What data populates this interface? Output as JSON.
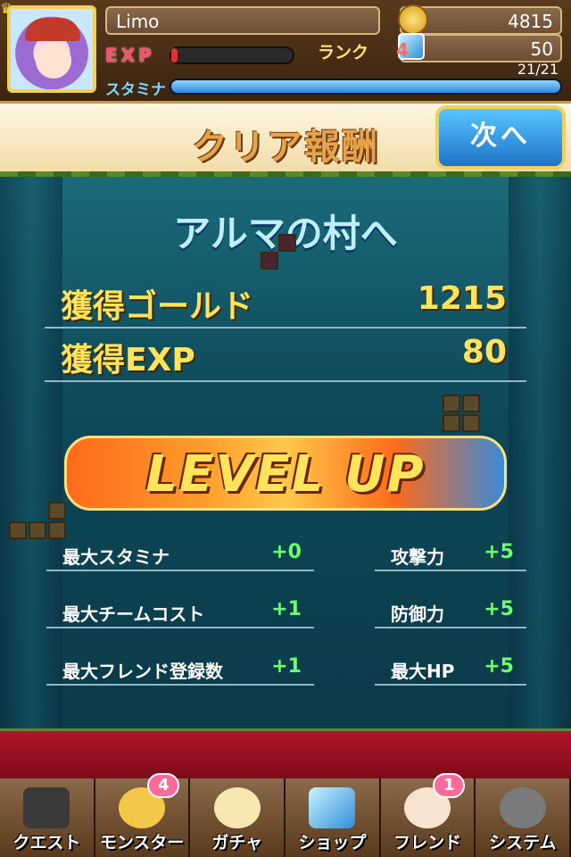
{
  "player": {
    "name": "Limo",
    "exp_label": "EXP",
    "exp_progress": 0.05,
    "rank_label": "ランク",
    "rank": "4",
    "gold": "4815",
    "gems": "50",
    "stamina_label": "スタミナ",
    "stamina": "21/21",
    "stamina_progress": 1.0
  },
  "header": {
    "title": "クリア報酬",
    "next_button": "次へ"
  },
  "stage": {
    "name": "アルマの村へ"
  },
  "rewards": [
    {
      "label": "獲得ゴールド",
      "value": "1215"
    },
    {
      "label": "獲得EXP",
      "value": "80"
    }
  ],
  "levelup": {
    "text": "LEVEL UP"
  },
  "stats_left": [
    {
      "label": "最大スタミナ",
      "value": "+0"
    },
    {
      "label": "最大チームコスト",
      "value": "+1"
    },
    {
      "label": "最大フレンド登録数",
      "value": "+1"
    }
  ],
  "stats_right": [
    {
      "label": "攻撃力",
      "value": "+5"
    },
    {
      "label": "防御力",
      "value": "+5"
    },
    {
      "label": "最大HP",
      "value": "+5"
    }
  ],
  "nav": [
    {
      "label": "クエスト",
      "badge": ""
    },
    {
      "label": "モンスター",
      "badge": "4"
    },
    {
      "label": "ガチャ",
      "badge": ""
    },
    {
      "label": "ショップ",
      "badge": ""
    },
    {
      "label": "フレンド",
      "badge": "1"
    },
    {
      "label": "システム",
      "badge": ""
    }
  ],
  "colors": {
    "gold_text": "#ffe35a",
    "stat_value": "#6bff6b",
    "next_button": "#2a8ad8",
    "badge": "#ff6a9a"
  }
}
